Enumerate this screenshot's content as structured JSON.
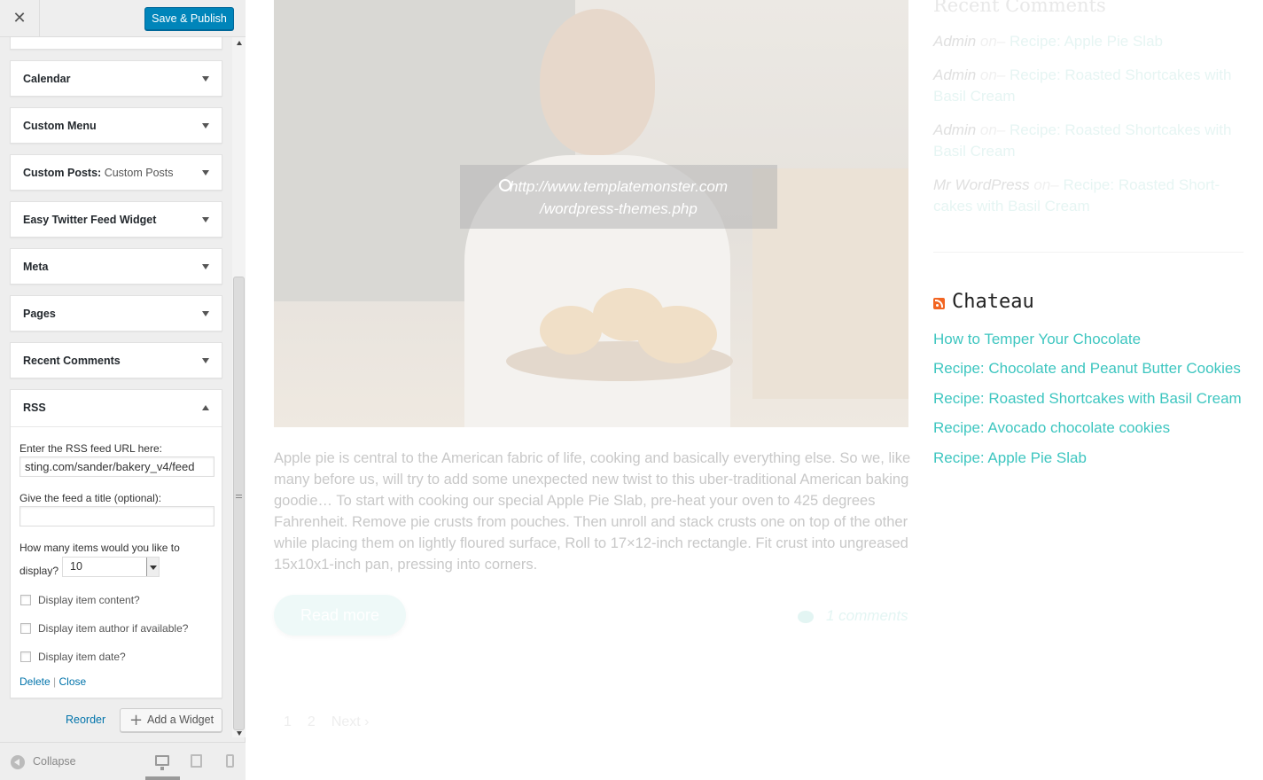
{
  "topbar": {
    "close_glyph": "✕",
    "publish_label": "Save & Publish"
  },
  "widgets": [
    {
      "title": "Calendar"
    },
    {
      "title": "Custom Menu"
    },
    {
      "title": "Custom Posts:",
      "subtitle": "Custom Posts"
    },
    {
      "title": "Easy Twitter Feed Widget"
    },
    {
      "title": "Meta"
    },
    {
      "title": "Pages"
    },
    {
      "title": "Recent Comments"
    },
    {
      "title": "RSS"
    }
  ],
  "rss_form": {
    "url_label": "Enter the RSS feed URL here:",
    "url_value": "sting.com/sander/bakery_v4/feed",
    "title_label": "Give the feed a title (optional):",
    "title_value": "",
    "items_label_1": "How many items would you like to",
    "items_label_2": "display?",
    "items_value": "10",
    "cb_content": "Display item content?",
    "cb_author": "Display item author if available?",
    "cb_date": "Display item date?",
    "delete_label": "Delete",
    "divider": "|",
    "close_label": "Close"
  },
  "sidebar_actions": {
    "reorder_label": "Reorder",
    "add_label": "Add a Widget",
    "add_glyph": "+"
  },
  "footer": {
    "collapse_label": "Collapse"
  },
  "post": {
    "link_url_1": "http://www.templatemonster.com",
    "link_url_2": "/wordpress-themes.php",
    "excerpt": "Apple pie is central to the American fabric of life, cooking and basically everything else. So we, like many before us, will try to add some unexpected new twist to this uber-traditional American baking goodie… To start with cooking our special Apple Pie Slab, pre-heat your oven to 425 degrees Fahrenheit. Remove pie crusts from pouches. Then unroll and stack crusts one on top of the other while placing them on lightly floured surface, Roll to 17×12-inch rectangle. Fit crust into ungreased 15x10x1-inch pan, pressing into corners.",
    "read_more": "Read more",
    "comments": "1 comments"
  },
  "pager": {
    "p1": "1",
    "p2": "2",
    "next": "Next ›"
  },
  "recent_comments": {
    "title": "Recent Comments",
    "items": [
      {
        "author": "Admin",
        "on": "on–",
        "post": "Recipe: Apple Pie Slab"
      },
      {
        "author": "Admin",
        "on": "on–",
        "post": "Recipe: Roasted Shortcakes with Basil Cream"
      },
      {
        "author": "Admin",
        "on": "on–",
        "post": "Recipe: Roasted Shortcakes with Basil Cream"
      },
      {
        "author": "Mr WordPress",
        "on": "on–",
        "post": "Recipe: Roasted Short-cakes with Basil Cream"
      }
    ]
  },
  "rss_widget": {
    "title": "Chateau",
    "links": [
      "How to Temper Your Chocolate",
      "Recipe: Chocolate and Peanut Butter Cookies",
      "Recipe: Roasted Shortcakes with Basil Cream",
      "Recipe: Avocado chocolate cookies",
      "Recipe: Apple Pie Slab"
    ]
  },
  "colors": {
    "accent": "#3ec6c0",
    "publish": "#0085ba",
    "link": "#0073aa"
  }
}
